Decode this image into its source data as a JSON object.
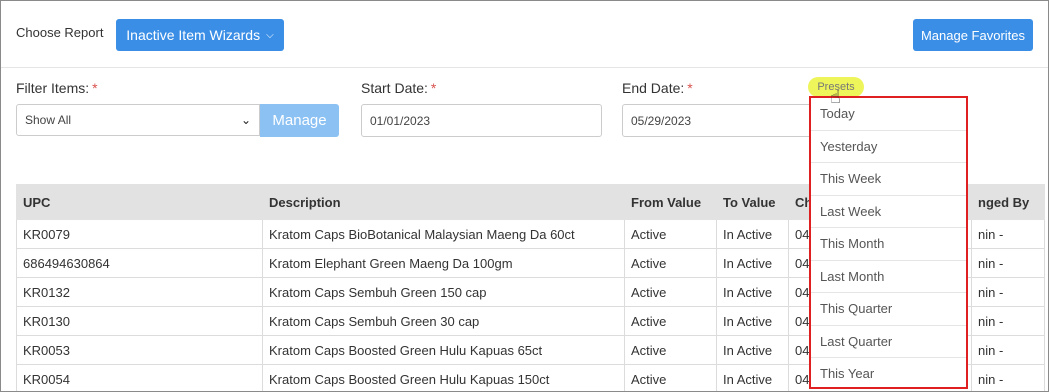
{
  "header": {
    "choose_report_label": "Choose Report",
    "report_button_label": "Inactive Item Wizards",
    "favorites_button_label": "Manage Favorites"
  },
  "filters": {
    "filter_items_label": "Filter Items:",
    "filter_items_value": "Show All",
    "manage_label": "Manage",
    "start_date_label": "Start Date:",
    "start_date_value": "01/01/2023",
    "end_date_label": "End Date:",
    "end_date_value": "05/29/2023",
    "required_mark": "*",
    "presets_label": "Presets"
  },
  "table": {
    "columns": [
      "UPC",
      "Description",
      "From Value",
      "To Value",
      "Cha",
      "nged By"
    ],
    "rows": [
      [
        "KR0079",
        "Kratom Caps BioBotanical Malaysian Maeng Da 60ct",
        "Active",
        "In Active",
        "04/",
        "nin -"
      ],
      [
        "686494630864",
        "Kratom Elephant Green Maeng Da 100gm",
        "Active",
        "In Active",
        "04/",
        "nin -"
      ],
      [
        "KR0132",
        "Kratom Caps Sembuh Green 150 cap",
        "Active",
        "In Active",
        "04/",
        "nin -"
      ],
      [
        "KR0130",
        "Kratom Caps Sembuh Green 30 cap",
        "Active",
        "In Active",
        "04/",
        "nin -"
      ],
      [
        "KR0053",
        "Kratom Caps Boosted Green Hulu Kapuas 65ct",
        "Active",
        "In Active",
        "04/",
        "nin -"
      ],
      [
        "KR0054",
        "Kratom Caps Boosted Green Hulu Kapuas 150ct",
        "Active",
        "In Active",
        "04/",
        "nin -"
      ]
    ]
  },
  "presets_menu": {
    "items": [
      "Today",
      "Yesterday",
      "This Week",
      "Last Week",
      "This Month",
      "Last Month",
      "This Quarter",
      "Last Quarter",
      "This Year"
    ]
  },
  "colors": {
    "primary": "#3a8ee6",
    "manage_disabled": "#8cc1f3",
    "highlight": "#eef55a",
    "outline_red": "#e02020"
  }
}
